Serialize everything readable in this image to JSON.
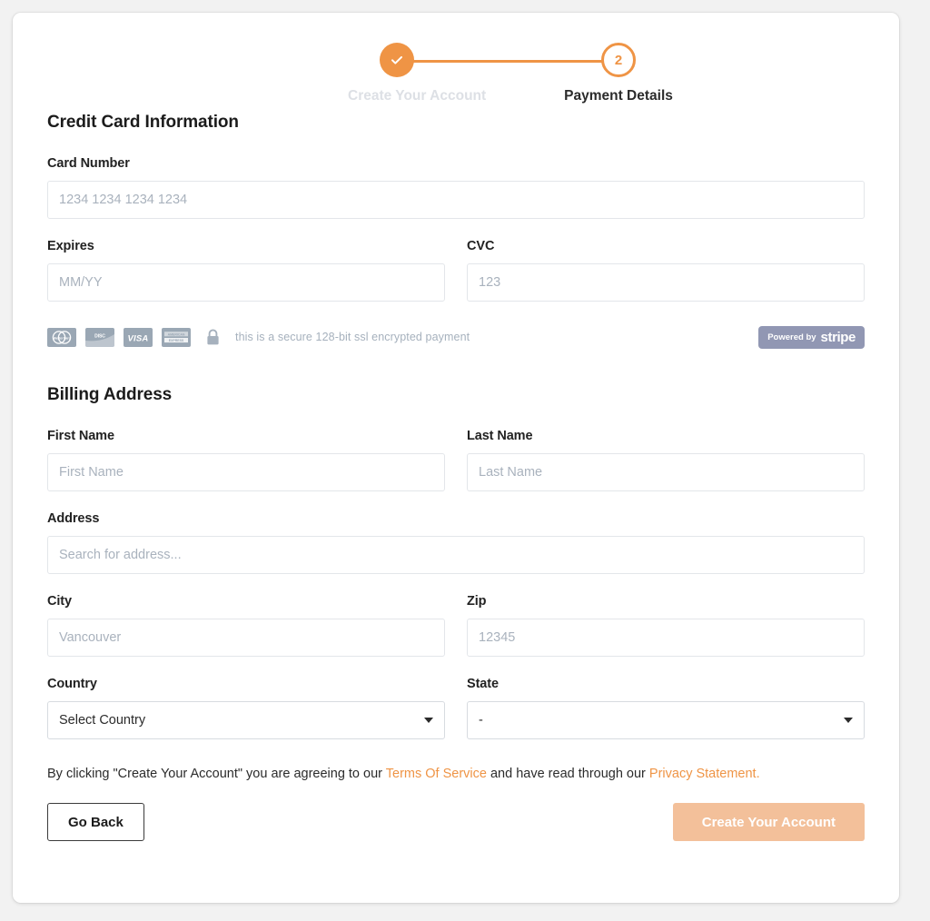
{
  "stepper": {
    "steps": [
      {
        "label": "Create Your Account",
        "state": "done",
        "marker": "check"
      },
      {
        "label": "Payment Details",
        "state": "current",
        "marker": "2"
      }
    ]
  },
  "credit_card": {
    "section_title": "Credit Card Information",
    "card_number": {
      "label": "Card Number",
      "placeholder": "1234 1234 1234 1234",
      "value": ""
    },
    "expires": {
      "label": "Expires",
      "placeholder": "MM/YY",
      "value": ""
    },
    "cvc": {
      "label": "CVC",
      "placeholder": "123",
      "value": ""
    }
  },
  "secure": {
    "card_brands": [
      "mastercard",
      "discover",
      "visa",
      "american-express"
    ],
    "lock_icon": "lock-icon",
    "text": "this is a secure 128-bit ssl encrypted payment",
    "stripe": {
      "prefix": "Powered by",
      "wordmark": "stripe"
    }
  },
  "billing": {
    "section_title": "Billing Address",
    "first_name": {
      "label": "First Name",
      "placeholder": "First Name",
      "value": ""
    },
    "last_name": {
      "label": "Last Name",
      "placeholder": "Last Name",
      "value": ""
    },
    "address": {
      "label": "Address",
      "placeholder": "Search for address...",
      "value": ""
    },
    "city": {
      "label": "City",
      "placeholder": "Vancouver",
      "value": ""
    },
    "zip": {
      "label": "Zip",
      "placeholder": "12345",
      "value": ""
    },
    "country": {
      "label": "Country",
      "selected": "Select Country"
    },
    "state": {
      "label": "State",
      "selected": "-"
    }
  },
  "legal": {
    "part1": "By clicking \"Create Your Account\" you are agreeing to our ",
    "link1": "Terms Of Service",
    "part2": " and have read through our ",
    "link2": "Privacy Statement."
  },
  "actions": {
    "back_label": "Go Back",
    "submit_label": "Create Your Account"
  },
  "colors": {
    "accent": "#ef9445",
    "accent_disabled": "#f3c09a",
    "muted": "#a6b1bd",
    "step_done_label": "#dde0e5",
    "stripe_bg": "#9197b3"
  }
}
